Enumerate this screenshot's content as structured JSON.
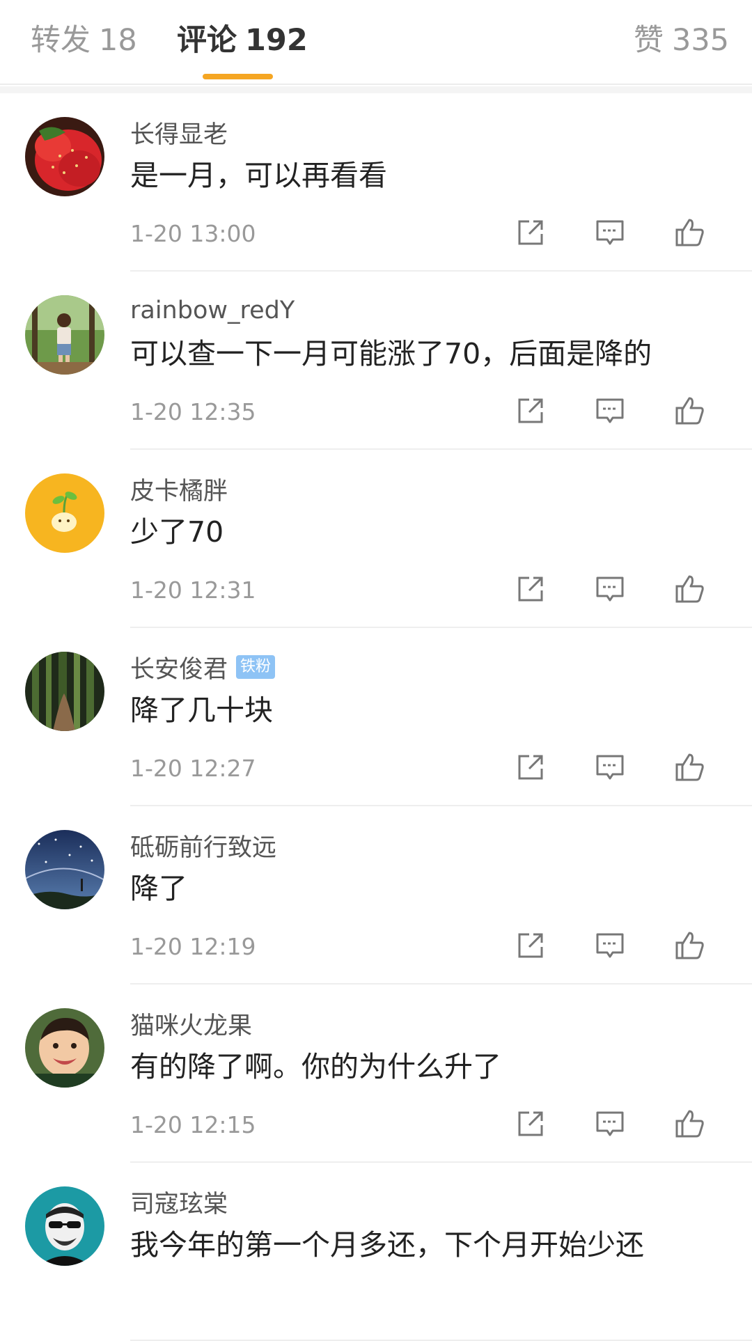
{
  "tabs": [
    {
      "label": "转发",
      "count": "18",
      "active": false
    },
    {
      "label": "评论",
      "count": "192",
      "active": true
    },
    {
      "label": "赞",
      "count": "335",
      "active": false
    }
  ],
  "accent_color": "#f5a623",
  "comments": [
    {
      "name": "长得显老",
      "badge": "",
      "text": "是一月，可以再看看",
      "time": "1-20 13:00",
      "avatar": "strawberry"
    },
    {
      "name": "rainbow_redY",
      "badge": "",
      "text": "可以查一下一月可能涨了70，后面是降的",
      "time": "1-20 12:35",
      "avatar": "girl-in-forest"
    },
    {
      "name": "皮卡橘胖",
      "badge": "",
      "text": "少了70",
      "time": "1-20 12:31",
      "avatar": "yellow-sprout"
    },
    {
      "name": "长安俊君",
      "badge": "铁粉",
      "text": "降了几十块",
      "time": "1-20 12:27",
      "avatar": "bamboo-forest"
    },
    {
      "name": "砥砺前行致远",
      "badge": "",
      "text": "降了",
      "time": "1-20 12:19",
      "avatar": "starry-sky"
    },
    {
      "name": "猫咪火龙果",
      "badge": "",
      "text": "有的降了啊。你的为什么升了",
      "time": "1-20 12:15",
      "avatar": "smiling-child"
    },
    {
      "name": "司寇玹棠",
      "badge": "",
      "text": "我今年的第一个月多还，下个月开始少还",
      "time": "",
      "avatar": "man-sunglasses"
    }
  ]
}
